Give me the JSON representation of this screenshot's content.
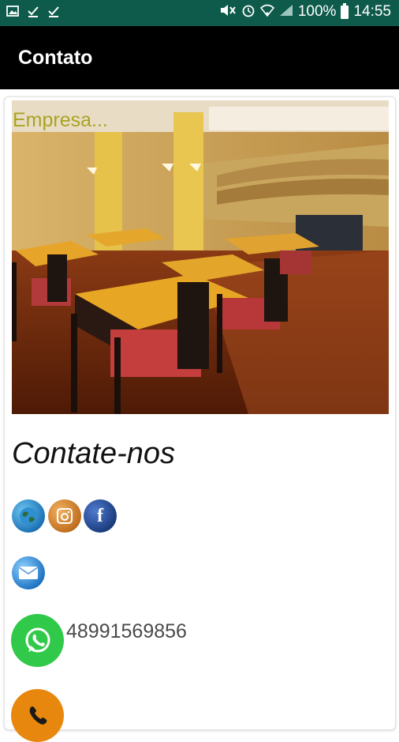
{
  "status_bar": {
    "battery": "100%",
    "time": "14:55"
  },
  "app_bar": {
    "title": "Contato"
  },
  "photo": {
    "caption": "Empresa..."
  },
  "contact": {
    "heading": "Contate-nos",
    "phone": "48991569856"
  },
  "icons": {
    "website": "globe-icon",
    "instagram": "instagram-icon",
    "facebook": "facebook-icon",
    "email": "email-icon",
    "whatsapp": "whatsapp-icon",
    "phone": "phone-icon"
  }
}
